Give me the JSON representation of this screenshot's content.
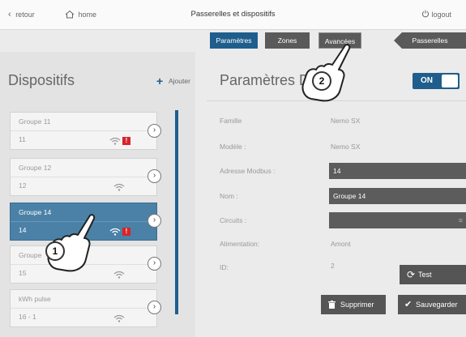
{
  "topbar": {
    "back": "retour",
    "home": "home",
    "title": "Passerelles et dispositifs",
    "logout": "logout"
  },
  "tabs": {
    "parametres": "Paramètres",
    "zones": "Zones",
    "avancees": "Avancées",
    "passerelles": "Passerelles"
  },
  "left": {
    "title": "Dispositifs",
    "add_label": "Ajouter",
    "devices": [
      {
        "name": "Groupe 11",
        "id": "11",
        "alarm": true,
        "selected": false
      },
      {
        "name": "Groupe 12",
        "id": "12",
        "alarm": false,
        "selected": false
      },
      {
        "name": "Groupe 14",
        "id": "14",
        "alarm": true,
        "selected": true
      },
      {
        "name": "Groupe",
        "id": "15",
        "alarm": false,
        "selected": false
      },
      {
        "name": "kWh pulse",
        "id": "16 - 1",
        "alarm": false,
        "selected": false
      }
    ],
    "badge_text": "!"
  },
  "right": {
    "title": "Paramètres Dis",
    "toggle": "ON",
    "fields": {
      "famille": {
        "label": "Famille",
        "value": "Nemo SX"
      },
      "modele": {
        "label": "Modèle :",
        "value": "Nemo SX"
      },
      "adresse": {
        "label": "Adresse Modbus :",
        "value": "14"
      },
      "nom": {
        "label": "Nom :",
        "value": "Groupe 14"
      },
      "circuits": {
        "label": "Circuits :",
        "value": ""
      },
      "alimentation": {
        "label": "Alimentation:",
        "value": "Amont"
      },
      "id": {
        "label": "ID:",
        "value": "2"
      }
    },
    "test": "Test",
    "supprimer": "Supprimer",
    "sauvegarder": "Sauvegarder"
  },
  "callouts": {
    "one": "1",
    "two": "2"
  },
  "colors": {
    "accent": "#1f5e8c",
    "selected": "#4b81a6",
    "alarm": "#d8232a"
  }
}
